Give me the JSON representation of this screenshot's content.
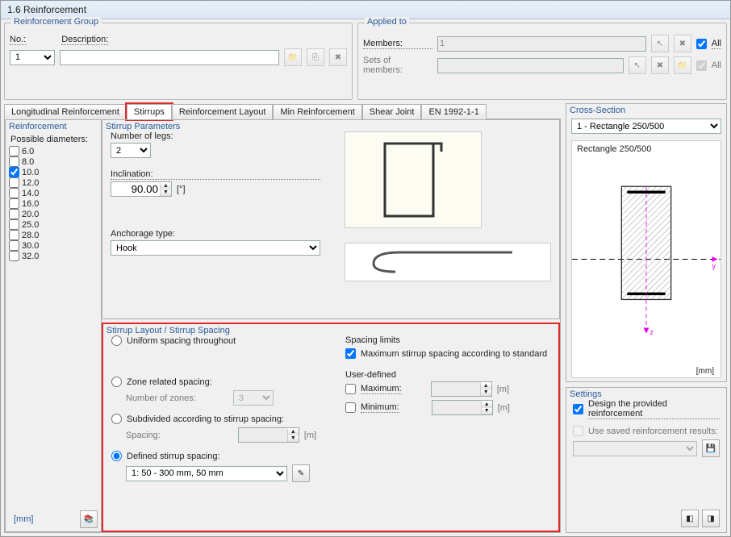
{
  "window": {
    "title": "1.6 Reinforcement"
  },
  "reinf_group": {
    "legend": "Reinforcement Group",
    "no_label": "No.:",
    "no_value": "1",
    "desc_label": "Description:",
    "desc_value": ""
  },
  "applied_to": {
    "legend": "Applied to",
    "members_label": "Members:",
    "members_value": "1",
    "sets_label": "Sets of members:",
    "sets_value": "",
    "all_label": "All"
  },
  "tabs": {
    "items": [
      {
        "label": "Longitudinal Reinforcement"
      },
      {
        "label": "Stirrups"
      },
      {
        "label": "Reinforcement Layout"
      },
      {
        "label": "Min Reinforcement"
      },
      {
        "label": "Shear Joint"
      },
      {
        "label": "EN 1992-1-1"
      }
    ],
    "active_index": 1
  },
  "reinforcement": {
    "legend": "Reinforcement",
    "possible_diameters_label": "Possible diameters:",
    "diameters": [
      {
        "val": "6.0",
        "checked": false
      },
      {
        "val": "8.0",
        "checked": false
      },
      {
        "val": "10.0",
        "checked": true
      },
      {
        "val": "12.0",
        "checked": false
      },
      {
        "val": "14.0",
        "checked": false
      },
      {
        "val": "16.0",
        "checked": false
      },
      {
        "val": "20.0",
        "checked": false
      },
      {
        "val": "25.0",
        "checked": false
      },
      {
        "val": "28.0",
        "checked": false
      },
      {
        "val": "30.0",
        "checked": false
      },
      {
        "val": "32.0",
        "checked": false
      }
    ],
    "unit": "[mm]"
  },
  "stirrup_params": {
    "legend": "Stirrup Parameters",
    "legs_label": "Number of legs:",
    "legs_value": "2",
    "incl_label": "Inclination:",
    "incl_value": "90.00",
    "incl_unit": "[°]",
    "anchorage_label": "Anchorage type:",
    "anchorage_value": "Hook"
  },
  "stirrup_layout": {
    "legend": "Stirrup Layout / Stirrup Spacing",
    "uniform_label": "Uniform spacing throughout",
    "zone_label": "Zone related spacing:",
    "num_zones_label": "Number of zones:",
    "num_zones_value": "3",
    "subdivided_label": "Subdivided according to stirrup spacing:",
    "spacing_label": "Spacing:",
    "spacing_unit": "[m]",
    "defined_label": "Defined stirrup spacing:",
    "defined_value": "1: 50 - 300 mm, 50 mm",
    "spacing_limits_label": "Spacing limits",
    "max_standard_label": "Maximum stirrup spacing according to standard",
    "user_defined_label": "User-defined",
    "max_label": "Maximum:",
    "min_label": "Minimum:",
    "unit_m": "[m]"
  },
  "cross_section": {
    "legend": "Cross-Section",
    "select_value": "1 - Rectangle 250/500",
    "label_text": "Rectangle 250/500",
    "unit": "[mm]",
    "axis_y": "y",
    "axis_z": "z"
  },
  "settings": {
    "legend": "Settings",
    "design_label": "Design the provided reinforcement",
    "saved_label": "Use saved reinforcement results:"
  },
  "chart_data": {
    "type": "diagram",
    "title": "Rectangle 250/500",
    "width_mm": 250,
    "height_mm": 500,
    "rebar_top": true,
    "rebar_bottom": true,
    "notes": "Rectangular concrete cross-section with hatched fill, top and bottom longitudinal bars.",
    "axes": {
      "horizontal": "y",
      "vertical": "z"
    }
  }
}
